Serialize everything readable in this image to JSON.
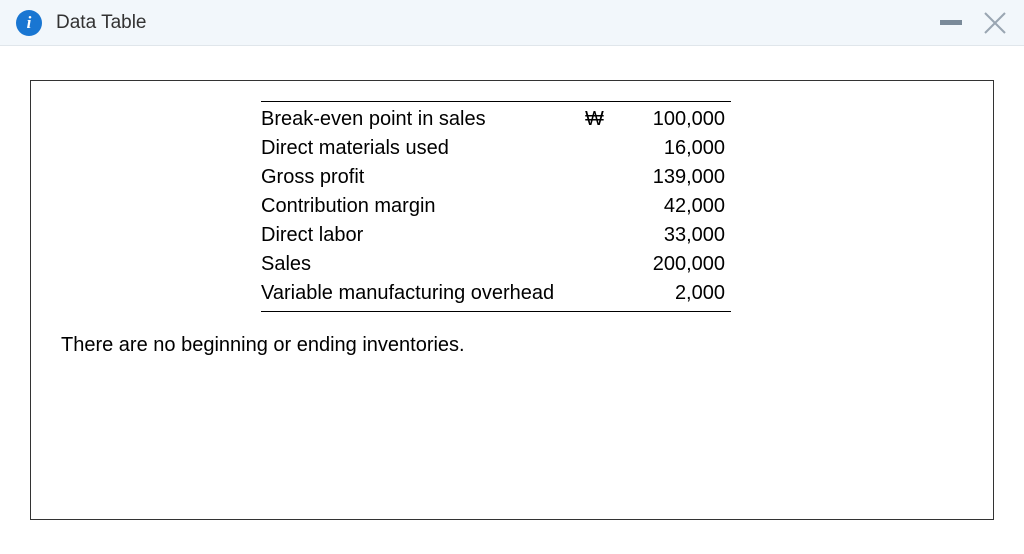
{
  "header": {
    "title": "Data Table"
  },
  "rows": [
    {
      "label": "Break-even point in sales",
      "currency": "₩",
      "value": "100,000"
    },
    {
      "label": "Direct materials used",
      "currency": "",
      "value": "16,000"
    },
    {
      "label": "Gross profit",
      "currency": "",
      "value": "139,000"
    },
    {
      "label": "Contribution margin",
      "currency": "",
      "value": "42,000"
    },
    {
      "label": "Direct labor",
      "currency": "",
      "value": "33,000"
    },
    {
      "label": "Sales",
      "currency": "",
      "value": "200,000"
    },
    {
      "label": "Variable manufacturing overhead",
      "currency": "",
      "value": "2,000"
    }
  ],
  "footnote": "There are no beginning or ending inventories."
}
